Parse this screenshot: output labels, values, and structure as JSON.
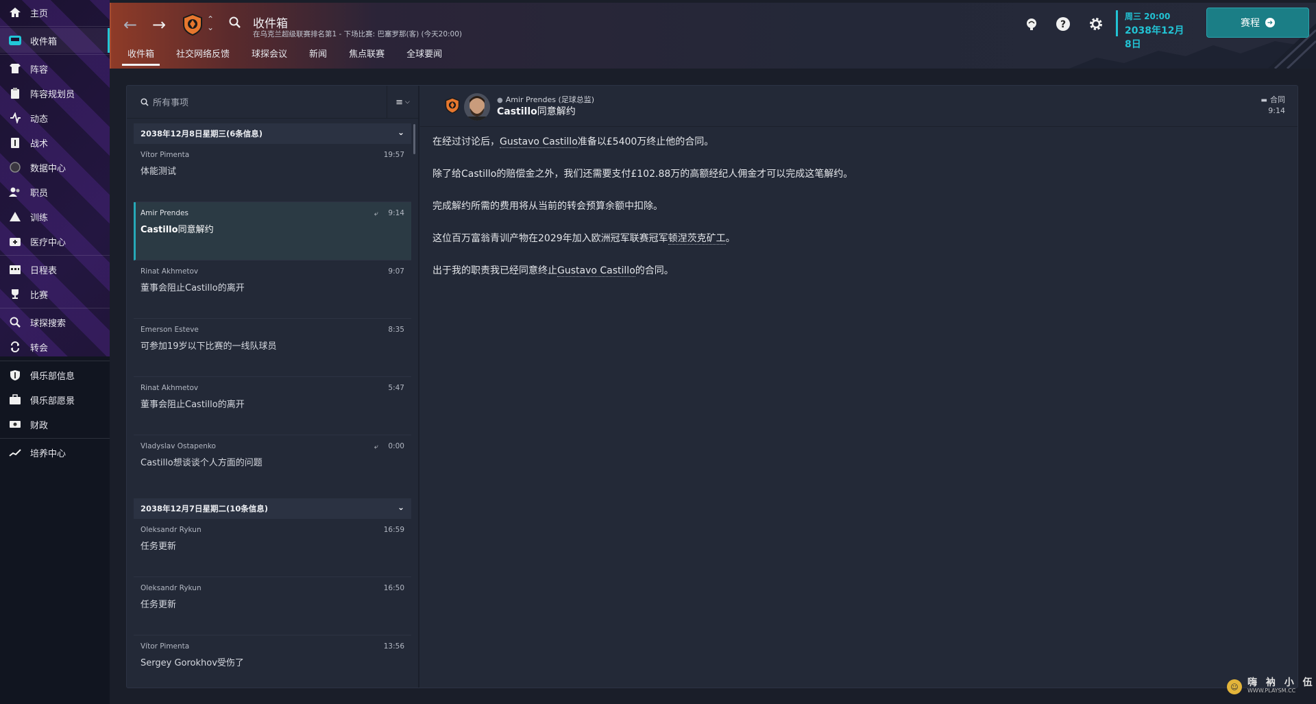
{
  "sidebar": {
    "items": [
      {
        "label": "主页",
        "icon": "home-icon"
      },
      {
        "label": "收件箱",
        "icon": "inbox-icon",
        "active": true
      },
      {
        "label": "阵容",
        "icon": "squad-icon"
      },
      {
        "label": "阵容规划员",
        "icon": "clipboard-icon"
      },
      {
        "label": "动态",
        "icon": "dynamics-icon"
      },
      {
        "label": "战术",
        "icon": "tactics-icon"
      },
      {
        "label": "数据中心",
        "icon": "data-hub-icon"
      },
      {
        "label": "职员",
        "icon": "staff-icon"
      },
      {
        "label": "训练",
        "icon": "training-icon"
      },
      {
        "label": "医疗中心",
        "icon": "medical-icon"
      },
      {
        "label": "日程表",
        "icon": "calendar-icon"
      },
      {
        "label": "比赛",
        "icon": "trophy-icon"
      },
      {
        "label": "球探搜索",
        "icon": "scouting-search-icon"
      },
      {
        "label": "转会",
        "icon": "transfer-icon"
      },
      {
        "label": "俱乐部信息",
        "icon": "shield-icon"
      },
      {
        "label": "俱乐部愿景",
        "icon": "briefcase-icon"
      },
      {
        "label": "财政",
        "icon": "finance-icon"
      },
      {
        "label": "培养中心",
        "icon": "development-icon"
      }
    ]
  },
  "header": {
    "title": "收件箱",
    "subtitle": "在乌克兰超级联赛排名第1 - 下场比赛: 巴塞罗那(客) (今天20:00)",
    "tabs": [
      "收件箱",
      "社交网络反馈",
      "球探会议",
      "新闻",
      "焦点联赛",
      "全球要闻"
    ],
    "date_day": "周三 20:00",
    "date_full": "2038年12月8日",
    "continue_label": "赛程"
  },
  "inbox": {
    "search_placeholder": "所有事项",
    "groups": [
      {
        "title": "2038年12月8日星期三(6条信息)",
        "messages": [
          {
            "sender": "Vítor Pimenta",
            "time": "19:57",
            "subject": "体能测试"
          },
          {
            "sender": "Amir Prendes",
            "time": "9:14",
            "subject_bold": "Castillo",
            "subject": "同意解约",
            "replied": true
          },
          {
            "sender": "Rinat Akhmetov",
            "time": "9:07",
            "subject": "董事会阻止Castillo的离开"
          },
          {
            "sender": "Emerson Esteve",
            "time": "8:35",
            "subject": "可参加19岁以下比赛的一线队球员"
          },
          {
            "sender": "Rinat Akhmetov",
            "time": "5:47",
            "subject": "董事会阻止Castillo的离开"
          },
          {
            "sender": "Vladyslav Ostapenko",
            "time": "0:00",
            "subject": "Castillo想谈谈个人方面的问题",
            "replied": true
          }
        ]
      },
      {
        "title": "2038年12月7日星期二(10条信息)",
        "messages": [
          {
            "sender": "Oleksandr Rykun",
            "time": "16:59",
            "subject": "任务更新"
          },
          {
            "sender": "Oleksandr Rykun",
            "time": "16:50",
            "subject": "任务更新"
          },
          {
            "sender": "Vítor Pimenta",
            "time": "13:56",
            "subject": "Sergey Gorokhov受伤了"
          }
        ]
      }
    ]
  },
  "detail": {
    "from": "Amir Prendes  (足球总监)",
    "subject_bold": "Castillo",
    "subject": "同意解约",
    "tag": "合同",
    "time": "9:14",
    "paragraphs": {
      "p1a": "在经过讨论后，",
      "p1link": "Gustavo Castillo",
      "p1b": "准备以£5400万终止他的合同。",
      "p2": "除了给Castillo的赔偿金之外，我们还需要支付£102.88万的高额经纪人佣金才可以完成这笔解约。",
      "p3": "完成解约所需的费用将从当前的转会预算余额中扣除。",
      "p4a": "这位百万富翁青训产物在2029年加入欧洲冠军联赛冠军",
      "p4link": "顿涅茨克矿工",
      "p4b": "。",
      "p5a": "出于我的职责我已经同意终止",
      "p5link": "Gustavo Castillo",
      "p5b": "的合同。"
    }
  },
  "watermark": {
    "big": "嗨 衲 小 伍",
    "small": "WWW.PLAYSM.CC"
  },
  "colors": {
    "accent": "#22c3d4",
    "continue_bg": "#1b7e86",
    "header_orange": "#8e3b28"
  }
}
